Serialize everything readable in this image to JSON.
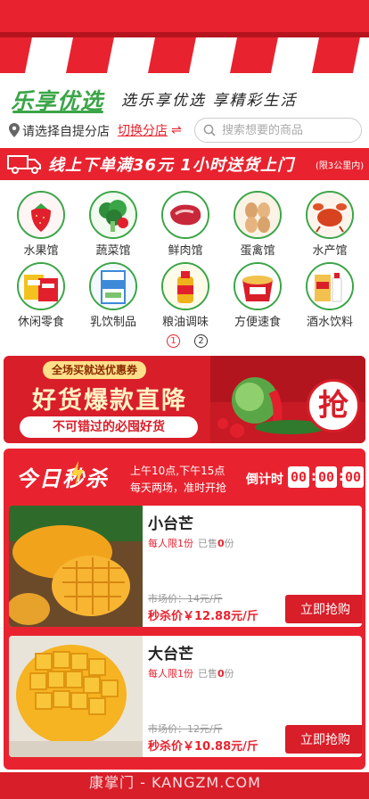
{
  "brand": {
    "logo": "乐享优选",
    "slogan": "选乐享优选  享精彩生活"
  },
  "store": {
    "pin_icon": "location-pin-icon",
    "label": "请选择自提分店",
    "switch_label": "切换分店",
    "switch_icon": "⇌"
  },
  "search": {
    "placeholder": "搜索想要的商品",
    "icon": "search-icon"
  },
  "delivery": {
    "text": "线上下单满36元 1小时送货上门",
    "note": "(限3公里内)",
    "icon": "truck-icon"
  },
  "categories": [
    {
      "label": "水果馆",
      "icon": "strawberry-icon"
    },
    {
      "label": "蔬菜馆",
      "icon": "broccoli-icon"
    },
    {
      "label": "鲜肉馆",
      "icon": "meat-icon"
    },
    {
      "label": "蛋禽馆",
      "icon": "eggs-icon"
    },
    {
      "label": "水产馆",
      "icon": "crayfish-icon"
    },
    {
      "label": "休闲零食",
      "icon": "snack-icon"
    },
    {
      "label": "乳饮制品",
      "icon": "milk-icon"
    },
    {
      "label": "粮油调味",
      "icon": "oil-icon"
    },
    {
      "label": "方便速食",
      "icon": "instant-noodle-icon"
    },
    {
      "label": "酒水饮料",
      "icon": "liquor-icon"
    }
  ],
  "pager": {
    "pages": [
      "1",
      "2"
    ],
    "active": 1
  },
  "promo": {
    "tag": "全场买就送优惠券",
    "title": "好货爆款直降",
    "subtitle": "不可错过的必囤好货",
    "badge": "抢"
  },
  "flash_sale": {
    "title": "今日秒杀",
    "desc1": "上午10点,下午15点",
    "desc2": "每天两场，准时开抢",
    "countdown_label": "倒计时",
    "countdown": [
      "00",
      "00",
      "00"
    ],
    "products": [
      {
        "name": "小台芒",
        "limit": "每人限1份",
        "sold_prefix": "已售",
        "sold": "0",
        "sold_suffix": "份",
        "market_price": "市场价：14元/斤",
        "sale_price": "秒杀价￥12.88元/斤",
        "button": "立即抢购"
      },
      {
        "name": "大台芒",
        "limit": "每人限1份",
        "sold_prefix": "已售",
        "sold": "0",
        "sold_suffix": "份",
        "market_price": "市场价：12元/斤",
        "sale_price": "秒杀价￥10.88元/斤",
        "button": "立即抢购"
      }
    ]
  },
  "watermark": "康掌门 - KANGZM.COM",
  "colors": {
    "brand_red": "#e8232f",
    "brand_green": "#3aa547"
  }
}
